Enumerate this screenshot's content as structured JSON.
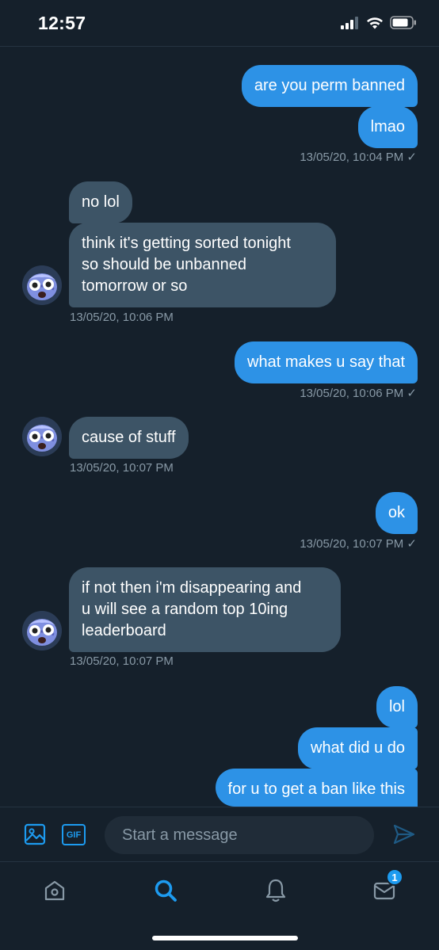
{
  "status": {
    "time": "12:57"
  },
  "messages": [
    {
      "dir": "out",
      "text": "are you perm banned"
    },
    {
      "dir": "out",
      "text": "lmao"
    },
    {
      "dir": "in",
      "text": "no lol"
    },
    {
      "dir": "in",
      "lines": [
        "think it's getting sorted tonight",
        "so should be unbanned",
        "tomorrow or so"
      ]
    },
    {
      "dir": "out",
      "text": "what makes u say that"
    },
    {
      "dir": "in",
      "text": "cause of stuff"
    },
    {
      "dir": "out",
      "text": "ok"
    },
    {
      "dir": "in",
      "lines": [
        "if not then i'm disappearing and",
        "u will see a random top 10ing",
        "leaderboard"
      ]
    },
    {
      "dir": "out",
      "text": "lol"
    },
    {
      "dir": "out",
      "text": "what did u do"
    },
    {
      "dir": "out",
      "text": "for u to get a ban like this"
    }
  ],
  "timestamps": [
    "13/05/20, 10:04 PM ✓",
    "13/05/20, 10:06 PM",
    "13/05/20, 10:06 PM ✓",
    "13/05/20, 10:07 PM",
    "13/05/20, 10:07 PM ✓",
    "13/05/20, 10:07 PM"
  ],
  "composer": {
    "placeholder": "Start a message",
    "gif_label": "GIF",
    "image_icon": "image-icon",
    "send_icon": "send-icon"
  },
  "tabbar": {
    "items": [
      "home-icon",
      "search-icon",
      "bell-icon",
      "mail-icon"
    ],
    "mail_badge": "1"
  },
  "colors": {
    "background": "#15202b",
    "outgoing_bubble": "#2d92e6",
    "incoming_bubble": "#3d5466",
    "accent": "#1d9bf0",
    "muted_text": "#8899a6"
  }
}
